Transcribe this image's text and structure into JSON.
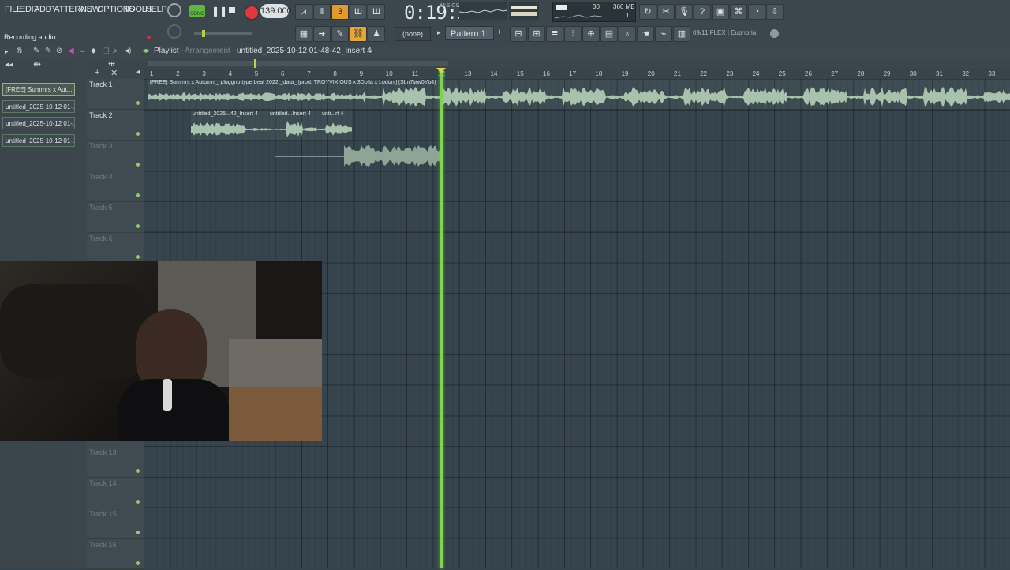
{
  "menu": {
    "items": [
      "FILE",
      "EDIT",
      "ADD",
      "PATTERNS",
      "VIEW",
      "OPTIONS",
      "TOOLS",
      "HELP"
    ]
  },
  "transport": {
    "song_mode_label": "SONG",
    "tempo": "139.000",
    "time": "0:19:32",
    "time_unit": "M:S:CS",
    "cpu_value": "30",
    "memory": "366 MB",
    "voices": "1"
  },
  "hint_bar": {
    "text": "Recording audio"
  },
  "pattern": {
    "none_label": "(none)",
    "name": "Pattern 1"
  },
  "preset": {
    "label": "09/11  FLEX | Euphoria"
  },
  "playlist": {
    "title": "Playlist",
    "arrangement": "Arrangement",
    "name": "untitled_2025-10-12 01-48-42_Insert 4"
  },
  "clip_sources": [
    "[FREE] Summrs x Aut...",
    "untitled_2025-10-12 01-...",
    "untitled_2025-10-12 01-...",
    "untitled_2025-10-12 01-..."
  ],
  "tracks": [
    {
      "name": "Track 1"
    },
    {
      "name": "Track 2"
    },
    {
      "name": "Track 3"
    },
    {
      "name": "Track 4"
    },
    {
      "name": "Track 5"
    },
    {
      "name": "Track 6"
    },
    {
      "name": "Track 13"
    },
    {
      "name": "Track 14"
    },
    {
      "name": "Track 15"
    },
    {
      "name": "Track 16"
    }
  ],
  "ruler": [
    "1",
    "2",
    "3",
    "4",
    "5",
    "6",
    "7",
    "8",
    "9",
    "10",
    "11",
    "12",
    "13",
    "14",
    "15",
    "16",
    "17",
    "18",
    "19",
    "20",
    "21",
    "22",
    "23",
    "24",
    "25",
    "26",
    "27",
    "28",
    "29",
    "30",
    "31",
    "32",
    "33"
  ],
  "clips": {
    "track1_header": "[FREE] Summrs x Autumn _ pluggnb type beat 2022 _data_ [prod. TROYVIXIOUS x 3Dolla x Lodoni] [SLn7law0Yb4]",
    "track2_clip1": "untitled_2025...42_Insert 4",
    "track2_clip2": "untitled...Insert 4",
    "track2_clip3": "unti...rt 4"
  },
  "colors": {
    "accent_green": "#7ed54d",
    "record_red": "#e0383c",
    "active_orange": "#e29a2c",
    "waveform": "#a9c2ad"
  }
}
